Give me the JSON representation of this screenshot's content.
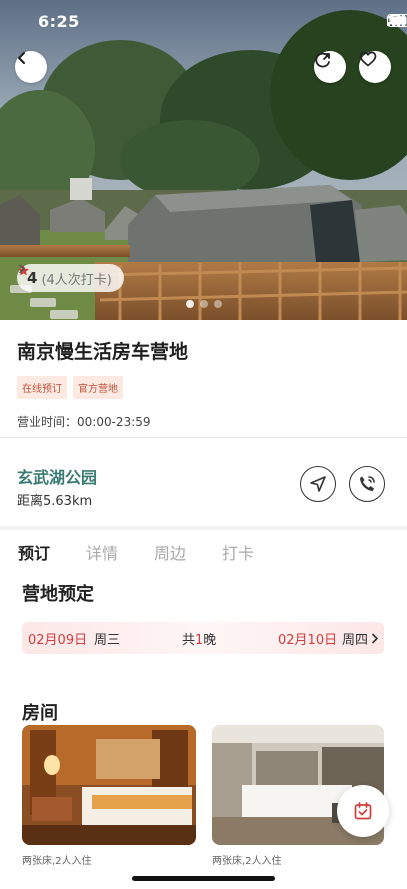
{
  "status_bar": {
    "time": "6:25"
  },
  "hero": {
    "rating": "4",
    "rating_count": "(4人次打卡)",
    "carousel_pages": 3,
    "carousel_active": 1
  },
  "camp": {
    "name": "南京慢生活房车营地",
    "tags": [
      "在线预订",
      "官方营地"
    ],
    "hours_label": "营业时间：",
    "hours_value": "00:00-23:59"
  },
  "location": {
    "name": "玄武湖公园",
    "distance": "距离5.63km"
  },
  "tabs": [
    {
      "label": "预订",
      "active": true
    },
    {
      "label": "详情",
      "active": false
    },
    {
      "label": "周边",
      "active": false
    },
    {
      "label": "打卡",
      "active": false
    }
  ],
  "booking": {
    "section_title": "营地预定",
    "checkin_date": "02月09日",
    "checkin_weekday": "周三",
    "nights_prefix": "共",
    "nights_count": "1",
    "nights_suffix": "晚",
    "checkout_date": "02月10日",
    "checkout_weekday": "周四"
  },
  "rooms": {
    "section_title": "房间",
    "items": [
      {
        "caption": "两张床,2人入住"
      },
      {
        "caption": "两张床,2人入住"
      }
    ]
  },
  "icons": {
    "back": "chevron-left-icon",
    "share": "share-refresh-icon",
    "favorite": "heart-icon",
    "star": "star-icon",
    "navigate": "navigation-arrow-icon",
    "call": "phone-call-icon",
    "calendar": "calendar-check-icon"
  },
  "colors": {
    "accent_red": "#d23c3c",
    "location_teal": "#3a7a74",
    "tag_text": "#c0533a",
    "tag_bg": "#fbe9e2"
  }
}
